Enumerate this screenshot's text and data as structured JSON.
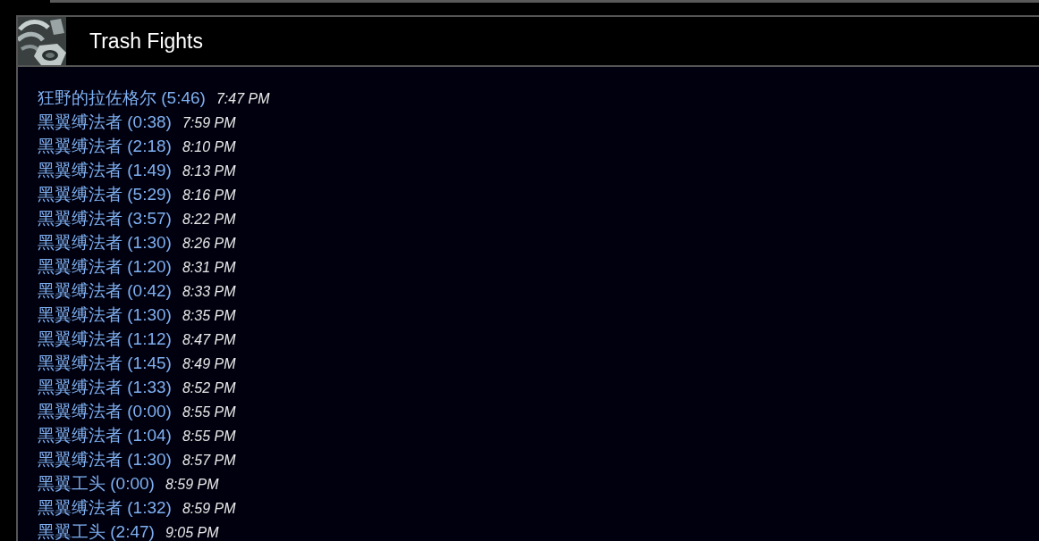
{
  "section": {
    "title": "Trash Fights"
  },
  "fights": [
    {
      "name": "狂野的拉佐格尔 (5:46)",
      "time": "7:47 PM"
    },
    {
      "name": "黑翼缚法者 (0:38)",
      "time": "7:59 PM"
    },
    {
      "name": "黑翼缚法者 (2:18)",
      "time": "8:10 PM"
    },
    {
      "name": "黑翼缚法者 (1:49)",
      "time": "8:13 PM"
    },
    {
      "name": "黑翼缚法者 (5:29)",
      "time": "8:16 PM"
    },
    {
      "name": "黑翼缚法者 (3:57)",
      "time": "8:22 PM"
    },
    {
      "name": "黑翼缚法者 (1:30)",
      "time": "8:26 PM"
    },
    {
      "name": "黑翼缚法者 (1:20)",
      "time": "8:31 PM"
    },
    {
      "name": "黑翼缚法者 (0:42)",
      "time": "8:33 PM"
    },
    {
      "name": "黑翼缚法者 (1:30)",
      "time": "8:35 PM"
    },
    {
      "name": "黑翼缚法者 (1:12)",
      "time": "8:47 PM"
    },
    {
      "name": "黑翼缚法者 (1:45)",
      "time": "8:49 PM"
    },
    {
      "name": "黑翼缚法者 (1:33)",
      "time": "8:52 PM"
    },
    {
      "name": "黑翼缚法者 (0:00)",
      "time": "8:55 PM"
    },
    {
      "name": "黑翼缚法者 (1:04)",
      "time": "8:55 PM"
    },
    {
      "name": "黑翼缚法者 (1:30)",
      "time": "8:57 PM"
    },
    {
      "name": "黑翼工头 (0:00)",
      "time": "8:59 PM"
    },
    {
      "name": "黑翼缚法者 (1:32)",
      "time": "8:59 PM"
    },
    {
      "name": "黑翼工头 (2:47)",
      "time": "9:05 PM"
    }
  ]
}
